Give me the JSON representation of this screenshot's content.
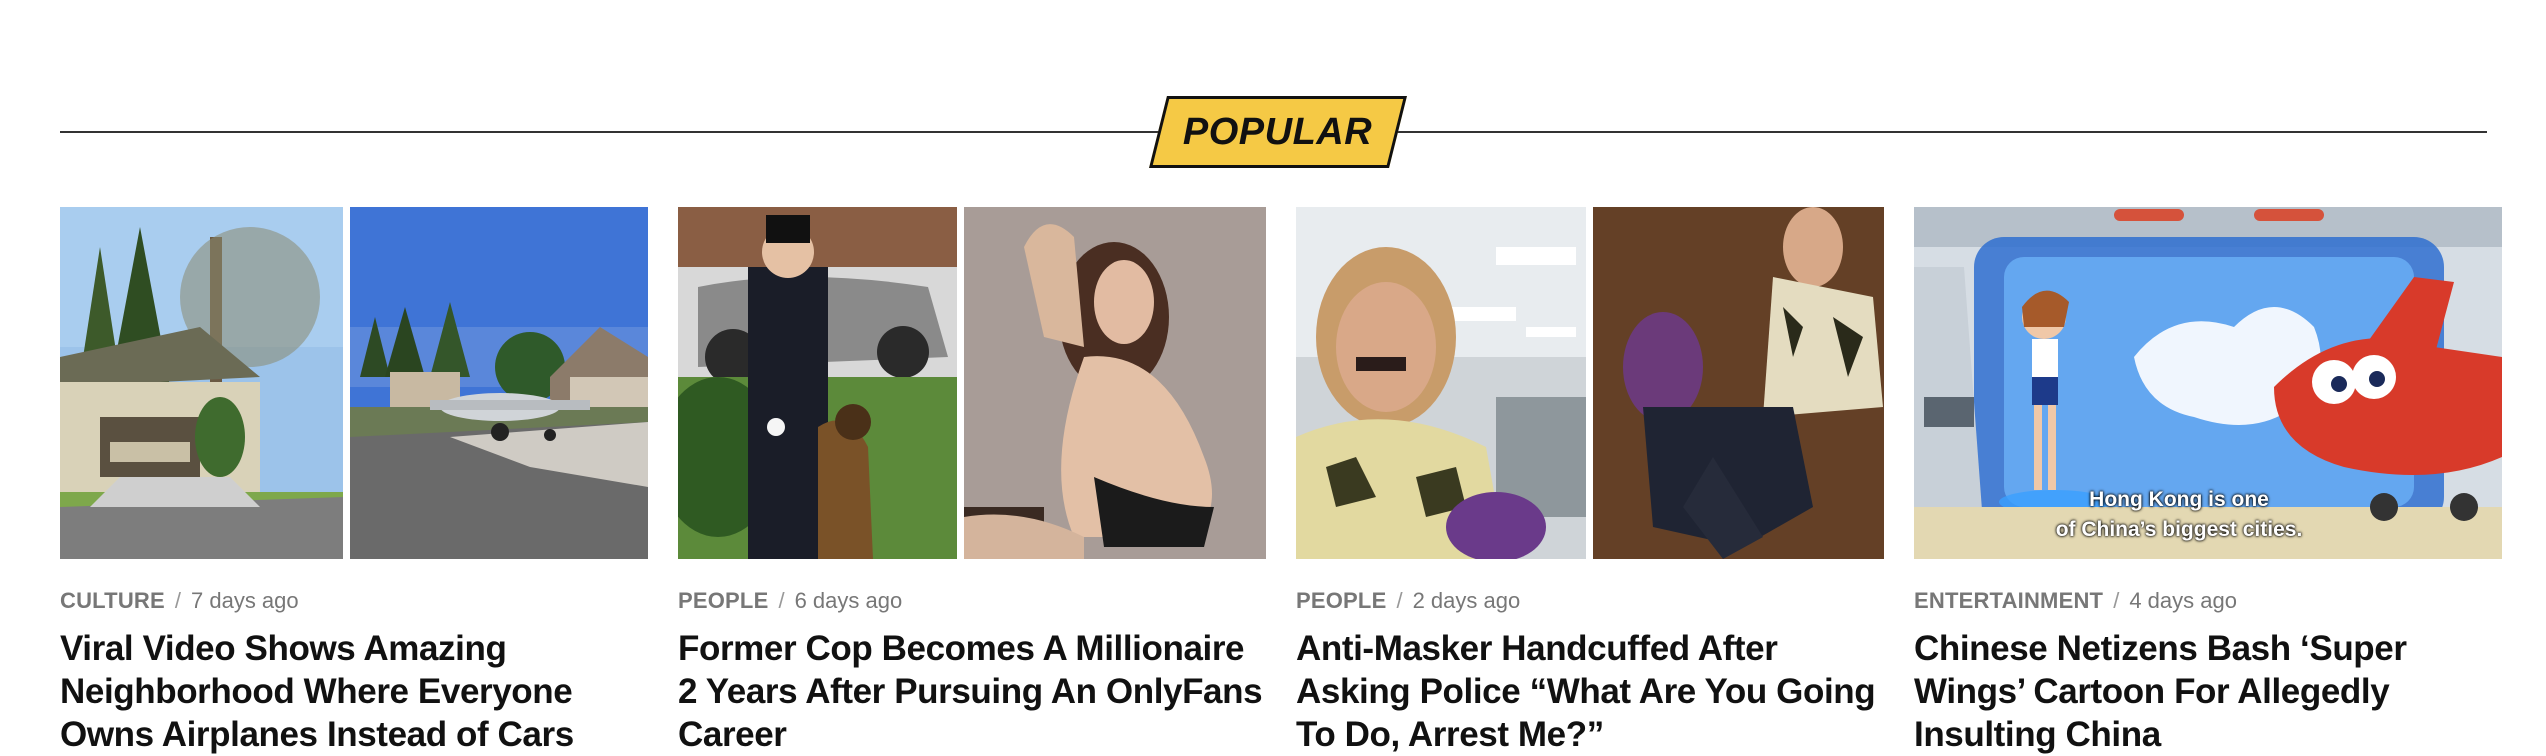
{
  "section": {
    "heading": "POPULAR"
  },
  "articles": [
    {
      "category": "CULTURE",
      "separator": "/",
      "time": "7 days ago",
      "title": "Viral Video Shows Amazing Neighborhood Where Everyone Owns Airplanes Instead of Cars"
    },
    {
      "category": "PEOPLE",
      "separator": "/",
      "time": "6 days ago",
      "title": "Former Cop Becomes A Millionaire 2 Years After Pursuing An OnlyFans Career"
    },
    {
      "category": "PEOPLE",
      "separator": "/",
      "time": "2 days ago",
      "title": "Anti-Masker Handcuffed After Asking Police “What Are You Going To Do, Arrest Me?”"
    },
    {
      "category": "ENTERTAINMENT",
      "separator": "/",
      "time": "4 days ago",
      "title": "Chinese Netizens Bash ‘Super Wings’ Cartoon For Allegedly Insulting China",
      "image_caption": [
        "Hong Kong is one",
        "of China’s biggest cities."
      ]
    }
  ],
  "colors": {
    "badge": "#f5c945",
    "rule": "#333333",
    "meta": "#777777",
    "title": "#111111"
  }
}
